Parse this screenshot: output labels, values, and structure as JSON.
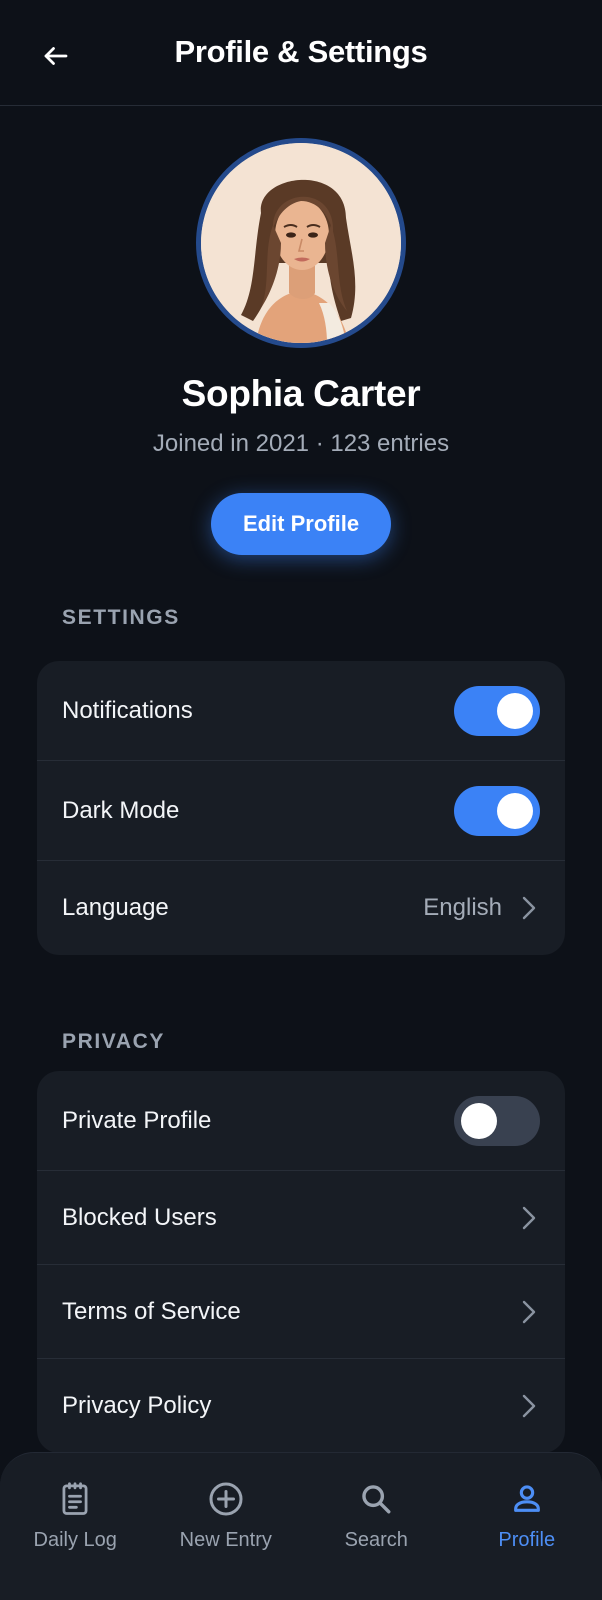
{
  "header": {
    "title": "Profile & Settings",
    "back_icon": "arrow-left-icon"
  },
  "profile": {
    "name": "Sophia Carter",
    "meta": "Joined in 2021 · 123 entries",
    "edit_label": "Edit Profile",
    "avatar_icon": "avatar-illustration"
  },
  "settings": {
    "label": "SETTINGS",
    "items": [
      {
        "label": "Notifications",
        "type": "toggle",
        "on": true
      },
      {
        "label": "Dark Mode",
        "type": "toggle",
        "on": true
      },
      {
        "label": "Language",
        "type": "link",
        "value": "English"
      }
    ]
  },
  "privacy": {
    "label": "PRIVACY",
    "items": [
      {
        "label": "Private Profile",
        "type": "toggle",
        "on": false
      },
      {
        "label": "Blocked Users",
        "type": "link"
      },
      {
        "label": "Terms of Service",
        "type": "link"
      },
      {
        "label": "Privacy Policy",
        "type": "link"
      }
    ]
  },
  "nav": {
    "items": [
      {
        "label": "Daily Log",
        "icon": "clipboard-icon",
        "active": false
      },
      {
        "label": "New Entry",
        "icon": "plus-circle-icon",
        "active": false
      },
      {
        "label": "Search",
        "icon": "search-icon",
        "active": false
      },
      {
        "label": "Profile",
        "icon": "user-icon",
        "active": true
      }
    ]
  },
  "colors": {
    "background": "#0d1118",
    "card": "#181d25",
    "accent": "#3b82f6",
    "toggle_off": "#394150",
    "muted_text": "#a4acb8"
  }
}
